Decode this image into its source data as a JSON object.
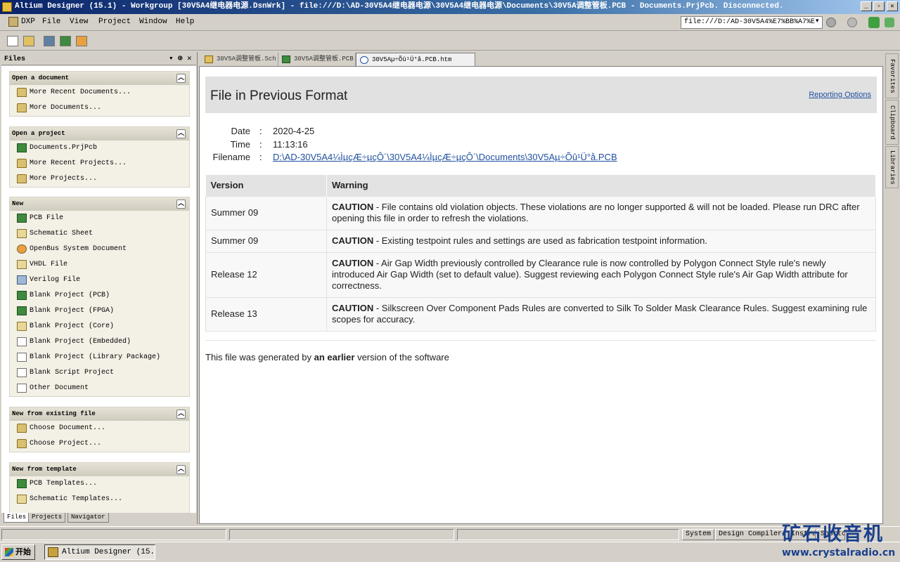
{
  "window": {
    "title": "Altium Designer (15.1) - Workgroup [30V5A4继电器电源.DsnWrk] - file:///D:\\AD-30V5A4继电器电源\\30V5A4继电器电源\\Documents\\30V5A调整管板.PCB - Documents.PrjPcb. Disconnected.",
    "minimize": "_",
    "maximize": "▫",
    "close": "✕"
  },
  "menubar": {
    "items": [
      "DXP",
      "File",
      "View",
      "Project",
      "Window",
      "Help"
    ],
    "address": "file:///D:/AD-30V5A4%E7%BB%A7%E",
    "address_arrow": "▾"
  },
  "left_panel": {
    "title": "Files",
    "controls": [
      "▾",
      "⊕",
      "✕"
    ],
    "sections": [
      {
        "title": "Open a document",
        "items": [
          {
            "label": "More Recent Documents...",
            "icon": "folder-icon"
          },
          {
            "label": "More Documents...",
            "icon": "folder-open-icon"
          }
        ]
      },
      {
        "title": "Open a project",
        "items": [
          {
            "label": "Documents.PrjPcb",
            "icon": "pcb-project-icon"
          },
          {
            "label": "More Recent Projects...",
            "icon": "folder-icon"
          },
          {
            "label": "More Projects...",
            "icon": "folder-open-icon"
          }
        ]
      },
      {
        "title": "New",
        "items": [
          {
            "label": "PCB File",
            "icon": "pcb-file-icon"
          },
          {
            "label": "Schematic Sheet",
            "icon": "schematic-icon"
          },
          {
            "label": "OpenBus System Document",
            "icon": "openbus-icon"
          },
          {
            "label": "VHDL File",
            "icon": "vhdl-icon"
          },
          {
            "label": "Verilog File",
            "icon": "verilog-icon"
          },
          {
            "label": "Blank Project (PCB)",
            "icon": "pcb-project-icon"
          },
          {
            "label": "Blank Project (FPGA)",
            "icon": "fpga-project-icon"
          },
          {
            "label": "Blank Project (Core)",
            "icon": "core-project-icon"
          },
          {
            "label": "Blank Project (Embedded)",
            "icon": "embedded-project-icon"
          },
          {
            "label": "Blank Project (Library Package)",
            "icon": "library-project-icon"
          },
          {
            "label": "Blank Script Project",
            "icon": "script-project-icon"
          },
          {
            "label": "Other Document",
            "icon": "document-icon"
          }
        ]
      },
      {
        "title": "New from existing file",
        "items": [
          {
            "label": "Choose Document...",
            "icon": "folder-open-icon"
          },
          {
            "label": "Choose Project...",
            "icon": "folder-open-icon"
          }
        ]
      },
      {
        "title": "New from template",
        "items": [
          {
            "label": "PCB Templates...",
            "icon": "pcb-file-icon"
          },
          {
            "label": "Schematic Templates...",
            "icon": "schematic-icon"
          }
        ]
      }
    ],
    "tabs": [
      "Files",
      "Projects",
      "Navigator"
    ]
  },
  "doc_tabs": [
    {
      "label": "30V5A调整管板.Sch",
      "active": false
    },
    {
      "label": "30V5A调整管板.PCB",
      "active": false
    },
    {
      "label": "30V5Aµ÷Õû¹Ü°å.PCB.htm",
      "active": true
    }
  ],
  "report": {
    "title": "File in Previous Format",
    "reporting_options": "Reporting Options",
    "date_label": "Date",
    "date": "2020-4-25",
    "time_label": "Time",
    "time": "11:13:16",
    "filename_label": "Filename",
    "filename": "D:\\AD-30V5A4¼ÌµçÆ÷µçÔ´\\30V5A4¼ÌµçÆ÷µçÔ´\\Documents\\30V5Aµ÷Õû¹Ü°å.PCB",
    "colon": ":",
    "table_headers": [
      "Version",
      "Warning"
    ],
    "rows": [
      {
        "version": "Summer 09",
        "tag": "CAUTION",
        "text": " - File contains old violation objects. These violations are no longer supported & will not be loaded. Please run DRC after opening this file in order to refresh the violations."
      },
      {
        "version": "Summer 09",
        "tag": "CAUTION",
        "text": " - Existing testpoint rules and settings are used as fabrication testpoint information."
      },
      {
        "version": "Release 12",
        "tag": "CAUTION",
        "text": " - Air Gap Width previously controlled by Clearance rule is now controlled by Polygon Connect Style rule's newly introduced Air Gap Width (set to default value). Suggest reviewing each Polygon Connect Style rule's Air Gap Width attribute for correctness."
      },
      {
        "version": "Release 13",
        "tag": "CAUTION",
        "text": " - Silkscreen Over Component Pads Rules are converted to Silk To Solder Mask Clearance Rules. Suggest examining rule scopes for accuracy."
      }
    ],
    "footer_pre": "This file was generated by ",
    "footer_bold": "an earlier",
    "footer_post": " version of the software"
  },
  "right_panels": [
    "Favorites",
    "Clipboard",
    "Libraries"
  ],
  "status_bar": {
    "buttons": [
      "System",
      "Design Compiler",
      "Instruments",
      "Shortcuts"
    ]
  },
  "taskbar": {
    "start": "开始",
    "task": "Altium Designer (15..."
  },
  "watermark": {
    "main": "矿石收音机",
    "url": "www.crystalradio.cn"
  }
}
